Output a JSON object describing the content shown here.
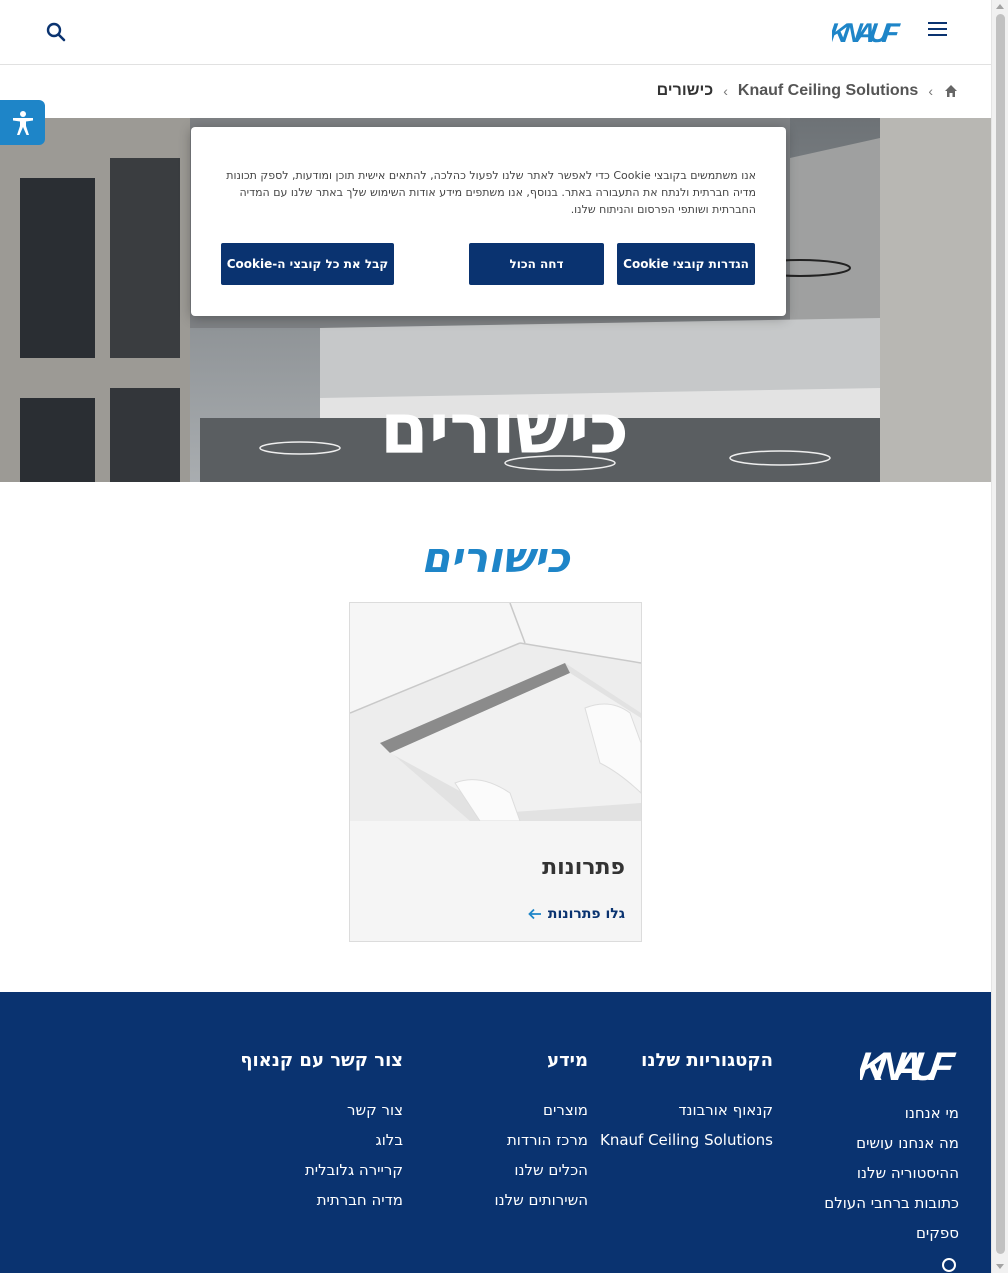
{
  "header": {
    "logo_text": "KNAUF",
    "colors": {
      "brand_dark": "#0a3370",
      "brand_light": "#1e85c8"
    }
  },
  "breadcrumb": {
    "home_icon": "home-icon",
    "items": [
      "Knauf Ceiling Solutions",
      "כישורים"
    ]
  },
  "hero": {
    "title": "כישורים"
  },
  "cookie": {
    "text": "אנו משתמשים בקובצי Cookie כדי לאפשר לאתר שלנו לפעול כהלכה, להתאים אישית תוכן ומודעות, לספק תכונות מדיה חברתית ולנתח את התעבורה באתר. בנוסף, אנו משתפים מידע אודות השימוש שלך באתר שלנו עם המדיה החברתית ושותפי הפרסום והניתוח שלנו.",
    "settings_label": "הגדרות קובצי Cookie",
    "reject_label": "דחה הכול",
    "accept_label": "קבל את כל קובצי ה-Cookie"
  },
  "main": {
    "title": "כישורים",
    "card": {
      "title": "פתרונות",
      "link": "גלו פתרונות"
    }
  },
  "footer": {
    "logo_text": "KNAUF",
    "col1": {
      "links": [
        "מי אנחנו",
        "מה אנחנו עושים",
        "ההיסטוריה שלנו",
        "כתובות ברחבי העולם",
        "ספקים"
      ]
    },
    "col2": {
      "heading": "הקטגוריות שלנו",
      "links": [
        "קנאוף אורבונד",
        "Knauf Ceiling Solutions"
      ]
    },
    "col3": {
      "heading": "מידע",
      "links": [
        "מוצרים",
        "מרכז הורדות",
        "הכלים שלנו",
        "השירותים שלנו"
      ]
    },
    "col4": {
      "heading": "צור קשר עם קנאוף",
      "links": [
        "צור קשר",
        "בלוג",
        "קריירה גלובלית",
        "מדיה חברתית"
      ]
    }
  }
}
